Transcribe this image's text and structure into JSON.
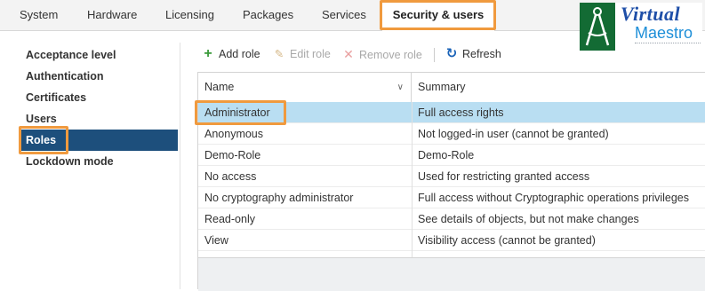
{
  "tabs": [
    {
      "label": "System"
    },
    {
      "label": "Hardware"
    },
    {
      "label": "Licensing"
    },
    {
      "label": "Packages"
    },
    {
      "label": "Services"
    },
    {
      "label": "Security & users",
      "active": true
    }
  ],
  "logo": {
    "word1": "Virtual",
    "word2": "Maestro"
  },
  "sidebar": {
    "items": [
      {
        "label": "Acceptance level"
      },
      {
        "label": "Authentication"
      },
      {
        "label": "Certificates"
      },
      {
        "label": "Users"
      },
      {
        "label": "Roles",
        "selected": true
      },
      {
        "label": "Lockdown mode"
      }
    ]
  },
  "toolbar": {
    "add_role": "Add role",
    "edit_role": "Edit role",
    "remove_role": "Remove role",
    "refresh": "Refresh"
  },
  "grid": {
    "columns": [
      "Name",
      "Summary"
    ],
    "rows": [
      {
        "name": "Administrator",
        "summary": "Full access rights",
        "selected": true
      },
      {
        "name": "Anonymous",
        "summary": "Not logged-in user (cannot be granted)"
      },
      {
        "name": "Demo-Role",
        "summary": "Demo-Role"
      },
      {
        "name": "No access",
        "summary": "Used for restricting granted access"
      },
      {
        "name": "No cryptography administrator",
        "summary": "Full access without Cryptographic operations privileges"
      },
      {
        "name": "Read-only",
        "summary": "See details of objects, but not make changes"
      },
      {
        "name": "View",
        "summary": "Visibility access (cannot be granted)"
      }
    ]
  },
  "colors": {
    "highlight": "#f09a3e",
    "sidebar_selected": "#1d4f7c",
    "row_selected": "#b9def2",
    "add_icon": "#3a9a3a",
    "remove_icon": "#e46c6c",
    "refresh_icon": "#1a63b8"
  },
  "icons": {
    "add": "plus-icon",
    "edit": "pencil-icon",
    "remove": "x-icon",
    "refresh": "refresh-icon",
    "sort": "chevron-down-icon"
  }
}
